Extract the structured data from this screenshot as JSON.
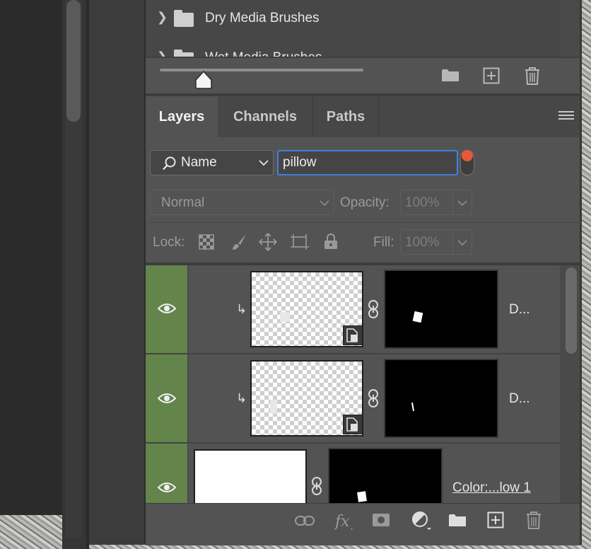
{
  "brushes": {
    "items": [
      {
        "label": "Dry Media Brushes"
      },
      {
        "label": "Wet Media Brushes"
      }
    ]
  },
  "tabs": [
    {
      "label": "Layers",
      "active": true
    },
    {
      "label": "Channels",
      "active": false
    },
    {
      "label": "Paths",
      "active": false
    }
  ],
  "filter": {
    "kind": "Name",
    "text": "pillow",
    "toggle_color": "#e9573a"
  },
  "blend": {
    "mode": "Normal",
    "opacity_label": "Opacity:",
    "opacity_value": "100%"
  },
  "lock": {
    "label": "Lock:",
    "fill_label": "Fill:",
    "fill_value": "100%"
  },
  "layers": [
    {
      "name": "D...",
      "visible": true,
      "clipped": true,
      "smart_object": true
    },
    {
      "name": "D...",
      "visible": true,
      "clipped": true,
      "smart_object": true
    },
    {
      "name": "Color:...low 1",
      "visible": true,
      "clipped": false,
      "smart_object": false
    }
  ],
  "colors": {
    "visibility_highlight": "#63844a",
    "focus_border": "#3f7fe0"
  }
}
